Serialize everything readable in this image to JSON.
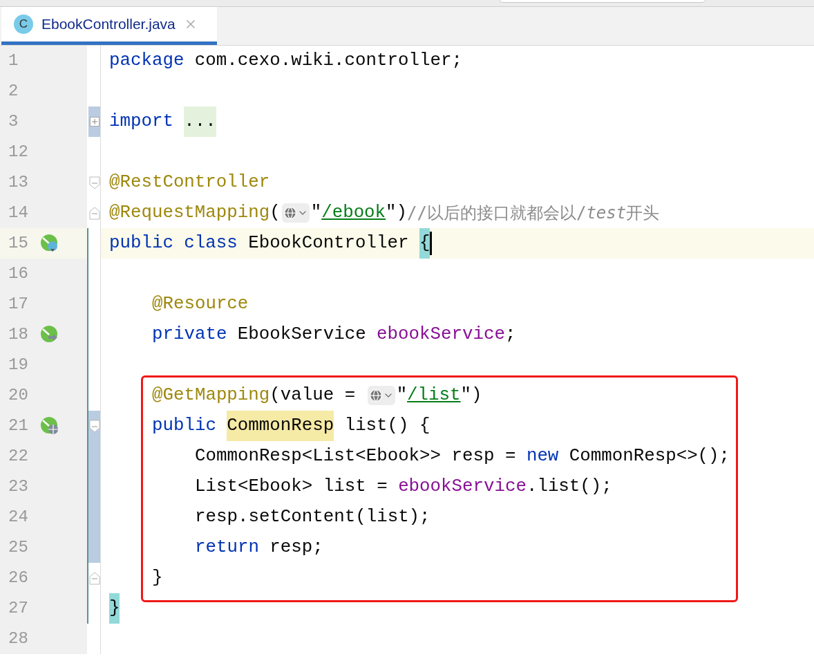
{
  "tab": {
    "icon_letter": "C",
    "label": "EbookController.java",
    "selected": true
  },
  "lines": [
    {
      "number": "1",
      "changed": false,
      "scope": false,
      "current": false,
      "boxed": false,
      "tokens": [
        {
          "kind": "kw",
          "text": "package"
        },
        {
          "kind": "plain",
          "text": " com.cexo.wiki.controller;"
        }
      ]
    },
    {
      "number": "2",
      "changed": false,
      "scope": false,
      "current": false,
      "boxed": false
    },
    {
      "number": "3",
      "fold": {
        "kind": "collapsed"
      },
      "changed": true,
      "scope": false,
      "current": false,
      "boxed": false,
      "tokens": [
        {
          "kind": "kw",
          "text": "import"
        },
        {
          "kind": "folded",
          "text": "..."
        }
      ]
    },
    {
      "number": "12",
      "changed": false,
      "scope": false,
      "current": false,
      "boxed": false
    },
    {
      "number": "13",
      "fold": {
        "kind": "start"
      },
      "changed": false,
      "scope": false,
      "current": false,
      "boxed": false,
      "tokens": [
        {
          "kind": "ann",
          "text": "@RestController"
        }
      ]
    },
    {
      "number": "14",
      "fold": {
        "kind": "end"
      },
      "changed": false,
      "scope": false,
      "current": false,
      "boxed": false,
      "tokens": [
        {
          "kind": "ann",
          "text": "@RequestMapping"
        },
        {
          "kind": "plain",
          "text": "("
        },
        {
          "kind": "chip"
        },
        {
          "kind": "plain",
          "text": "\""
        },
        {
          "kind": "link",
          "text": "/ebook"
        },
        {
          "kind": "plain",
          "text": "\")"
        },
        {
          "kind": "comment",
          "text": "//以后的接口就都会以/"
        },
        {
          "kind": "comment_italic",
          "text": "test"
        },
        {
          "kind": "comment",
          "text": "开头"
        }
      ]
    },
    {
      "number": "15",
      "gutter_icon": {
        "kind": "bean-class"
      },
      "changed": false,
      "scope": true,
      "current": true,
      "boxed": false,
      "tokens": [
        {
          "kind": "kw",
          "text": "public class"
        },
        {
          "kind": "plain",
          "text": " EbookController "
        },
        {
          "kind": "brace",
          "text": "{"
        }
      ],
      "children": [
        {
          "number": "16",
          "changed": false,
          "scope": true,
          "current": false,
          "boxed": false
        },
        {
          "number": "17",
          "changed": false,
          "scope": true,
          "current": false,
          "boxed": false,
          "tokens": [
            {
              "kind": "ann",
              "text": "@Resource"
            }
          ]
        },
        {
          "number": "18",
          "gutter_icon": {
            "kind": "bean-field"
          },
          "changed": false,
          "scope": true,
          "current": false,
          "boxed": false,
          "tokens": [
            {
              "kind": "kw",
              "text": "private"
            },
            {
              "kind": "plain",
              "text": " EbookService "
            },
            {
              "kind": "field",
              "text": "ebookService"
            },
            {
              "kind": "plain",
              "text": ";"
            }
          ]
        },
        {
          "number": "19",
          "changed": false,
          "scope": true,
          "current": false,
          "boxed": false
        },
        {
          "number": "20",
          "changed": false,
          "scope": true,
          "current": false,
          "boxed": true,
          "tokens": [
            {
              "kind": "ann",
              "text": "@GetMapping"
            },
            {
              "kind": "plain",
              "text": "(value = "
            },
            {
              "kind": "chip"
            },
            {
              "kind": "plain",
              "text": "\""
            },
            {
              "kind": "link",
              "text": "/list"
            },
            {
              "kind": "plain",
              "text": "\")"
            }
          ]
        },
        {
          "number": "21",
          "gutter_icon": {
            "kind": "endpoint"
          },
          "fold": {
            "kind": "start"
          },
          "changed": true,
          "scope": true,
          "current": false,
          "boxed": true,
          "tokens": [
            {
              "kind": "kw",
              "text": "public"
            },
            {
              "kind": "match",
              "text": "CommonResp"
            },
            {
              "kind": "plain",
              "text": " list() {"
            }
          ],
          "children": [
            {
              "number": "22",
              "changed": true,
              "scope": true,
              "current": false,
              "boxed": true,
              "tokens": [
                {
                  "kind": "plain",
                  "text": "CommonResp<List<Ebook>> resp = "
                },
                {
                  "kind": "kw",
                  "text": "new"
                },
                {
                  "kind": "plain",
                  "text": " CommonResp<>();"
                }
              ]
            },
            {
              "number": "23",
              "changed": true,
              "scope": true,
              "current": false,
              "boxed": true,
              "tokens": [
                {
                  "kind": "plain",
                  "text": "List<Ebook> list = "
                },
                {
                  "kind": "field",
                  "text": "ebookService"
                },
                {
                  "kind": "plain",
                  "text": ".list();"
                }
              ]
            },
            {
              "number": "24",
              "changed": true,
              "scope": true,
              "current": false,
              "boxed": true,
              "tokens": [
                {
                  "kind": "plain",
                  "text": "resp.setContent(list);"
                }
              ]
            },
            {
              "number": "25",
              "changed": true,
              "scope": true,
              "current": false,
              "boxed": true,
              "tokens": [
                {
                  "kind": "kw",
                  "text": "return"
                },
                {
                  "kind": "plain",
                  "text": " resp;"
                }
              ]
            }
          ]
        },
        {
          "number": "26",
          "fold": {
            "kind": "end"
          },
          "changed": false,
          "scope": true,
          "current": false,
          "boxed": true,
          "tokens": [
            {
              "kind": "plain",
              "text": "}"
            }
          ]
        }
      ]
    },
    {
      "number": "27",
      "changed": false,
      "scope": true,
      "current": false,
      "boxed": false,
      "tokens": [
        {
          "kind": "brace",
          "text": "}"
        }
      ]
    },
    {
      "number": "28",
      "changed": false,
      "scope": false,
      "current": false,
      "boxed": false
    }
  ]
}
